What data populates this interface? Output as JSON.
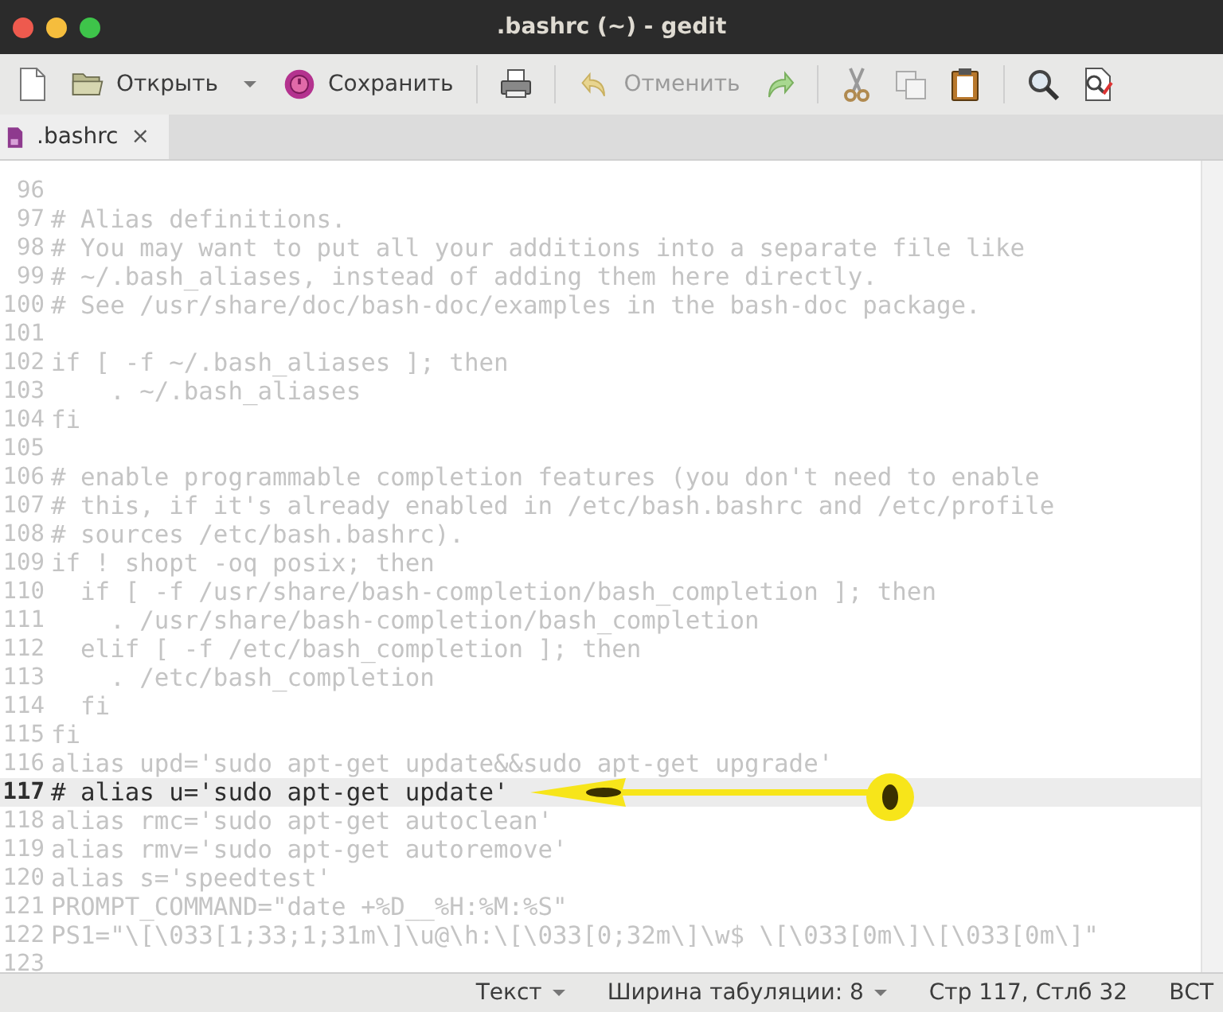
{
  "window": {
    "title": ".bashrc (~) - gedit"
  },
  "toolbar": [
    {
      "kind": "new"
    },
    {
      "kind": "open",
      "label": "Открыть",
      "disabled": false
    },
    {
      "kind": "dropdown"
    },
    {
      "kind": "save",
      "label": "Сохранить",
      "disabled": false
    },
    {
      "kind": "sep"
    },
    {
      "kind": "print"
    },
    {
      "kind": "sep"
    },
    {
      "kind": "undo",
      "label": "Отменить",
      "disabled": true
    },
    {
      "kind": "redo"
    },
    {
      "kind": "sep"
    },
    {
      "kind": "cut"
    },
    {
      "kind": "copy"
    },
    {
      "kind": "paste"
    },
    {
      "kind": "sep"
    },
    {
      "kind": "find"
    },
    {
      "kind": "replace"
    }
  ],
  "tabs": [
    {
      "label": ".bashrc",
      "close": "×",
      "selected": true
    }
  ],
  "editor": {
    "lines": [
      {
        "number": "96",
        "current": false
      },
      {
        "number": "97",
        "text": "# Alias definitions.",
        "current": false
      },
      {
        "number": "98",
        "text": "# You may want to put all your additions into a separate file like",
        "current": false
      },
      {
        "number": "99",
        "text": "# ~/.bash_aliases, instead of adding them here directly.",
        "current": false
      },
      {
        "number": "100",
        "text": "# See /usr/share/doc/bash-doc/examples in the bash-doc package.",
        "current": false
      },
      {
        "number": "101",
        "current": false
      },
      {
        "number": "102",
        "text": "if [ -f ~/.bash_aliases ]; then",
        "current": false
      },
      {
        "number": "103",
        "text": "    . ~/.bash_aliases",
        "current": false
      },
      {
        "number": "104",
        "text": "fi",
        "current": false
      },
      {
        "number": "105",
        "current": false
      },
      {
        "number": "106",
        "text": "# enable programmable completion features (you don't need to enable",
        "current": false
      },
      {
        "number": "107",
        "text": "# this, if it's already enabled in /etc/bash.bashrc and /etc/profile",
        "current": false
      },
      {
        "number": "108",
        "text": "# sources /etc/bash.bashrc).",
        "current": false
      },
      {
        "number": "109",
        "text": "if ! shopt -oq posix; then",
        "current": false
      },
      {
        "number": "110",
        "text": "  if [ -f /usr/share/bash-completion/bash_completion ]; then",
        "current": false
      },
      {
        "number": "111",
        "text": "    . /usr/share/bash-completion/bash_completion",
        "current": false
      },
      {
        "number": "112",
        "text": "  elif [ -f /etc/bash_completion ]; then",
        "current": false
      },
      {
        "number": "113",
        "text": "    . /etc/bash_completion",
        "current": false
      },
      {
        "number": "114",
        "text": "  fi",
        "current": false
      },
      {
        "number": "115",
        "text": "fi",
        "current": false
      },
      {
        "number": "116",
        "text": "alias upd='sudo apt-get update&&sudo apt-get upgrade'",
        "current": false
      },
      {
        "number": "117",
        "text": "# alias u='sudo apt-get update'",
        "current": true
      },
      {
        "number": "118",
        "text": "alias rmc='sudo apt-get autoclean'",
        "current": false
      },
      {
        "number": "119",
        "text": "alias rmv='sudo apt-get autoremove'",
        "current": false
      },
      {
        "number": "120",
        "text": "alias s='speedtest'",
        "current": false
      },
      {
        "number": "121",
        "text": "PROMPT_COMMAND=\"date +%D__%H:%M:%S\"",
        "current": false
      },
      {
        "number": "122",
        "text": "PS1=\"\\[\\033[1;33;1;31m\\]\\u@\\h:\\[\\033[0;32m\\]\\w$ \\[\\033[0m\\]\\[\\033[0m\\]\"",
        "current": false
      },
      {
        "number": "123",
        "current": false
      }
    ]
  },
  "status_bar": [
    {
      "kind": "menu",
      "label": "Текст"
    },
    {
      "kind": "menu",
      "label": "Ширина табуляции: 8"
    },
    {
      "kind": "text",
      "label": "Стр 117, Стлб 32"
    },
    {
      "kind": "text",
      "label": "ВСТ"
    }
  ]
}
